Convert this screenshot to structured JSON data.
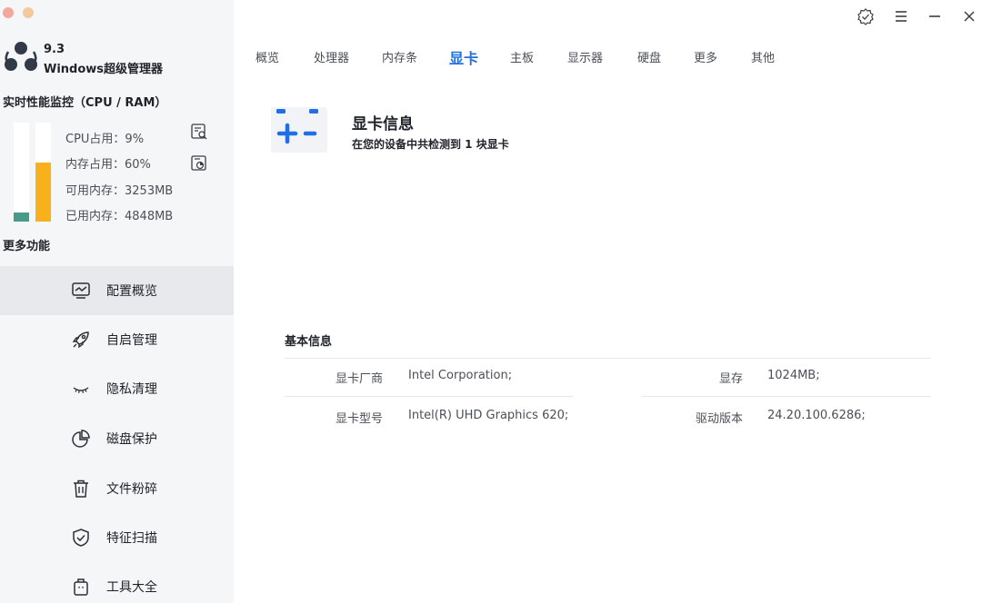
{
  "app": {
    "version": "9.3",
    "name": "Windows超级管理器"
  },
  "sidebar": {
    "perf_title": "实时性能监控（CPU / RAM）",
    "cpu_usage_percent": 9,
    "mem_usage_percent": 60,
    "stats": {
      "cpu": "CPU占用：9%",
      "mem": "内存占用：60%",
      "avail": "可用内存：3253MB",
      "used": "已用内存：4848MB"
    },
    "more_title": "更多功能",
    "nav": [
      {
        "label": "配置概览",
        "icon": "monitor-chart-icon",
        "active": true
      },
      {
        "label": "自启管理",
        "icon": "rocket-icon",
        "active": false
      },
      {
        "label": "隐私清理",
        "icon": "closed-eye-icon",
        "active": false
      },
      {
        "label": "磁盘保护",
        "icon": "pie-chart-icon",
        "active": false
      },
      {
        "label": "文件粉碎",
        "icon": "trash-icon",
        "active": false
      },
      {
        "label": "特征扫描",
        "icon": "shield-check-icon",
        "active": false
      },
      {
        "label": "工具大全",
        "icon": "toolbox-icon",
        "active": false
      }
    ]
  },
  "header": {
    "icons": [
      "badge-check-icon",
      "menu-icon",
      "minimize-icon",
      "close-icon"
    ]
  },
  "tabs": [
    {
      "label": "概览",
      "active": false
    },
    {
      "label": "处理器",
      "active": false
    },
    {
      "label": "内存条",
      "active": false
    },
    {
      "label": "显卡",
      "active": true
    },
    {
      "label": "主板",
      "active": false
    },
    {
      "label": "显示器",
      "active": false
    },
    {
      "label": "硬盘",
      "active": false
    },
    {
      "label": "更多",
      "active": false
    },
    {
      "label": "其他",
      "active": false
    }
  ],
  "gpu": {
    "title": "显卡信息",
    "subtitle": "在您的设备中共检测到 1 块显卡"
  },
  "basic": {
    "title": "基本信息",
    "vendor_label": "显卡厂商",
    "vendor_value": "Intel Corporation;",
    "vram_label": "显存",
    "vram_value": "1024MB;",
    "model_label": "显卡型号",
    "model_value": "Intel(R) UHD Graphics 620;",
    "driver_label": "驱动版本",
    "driver_value": "24.20.100.6286;"
  },
  "colors": {
    "accent": "#1f6fe5",
    "cpu_bar": "#4a9a8c",
    "mem_bar": "#f7b21b",
    "traffic_red": "#f4a79e",
    "traffic_yellow": "#f5c9a0"
  }
}
